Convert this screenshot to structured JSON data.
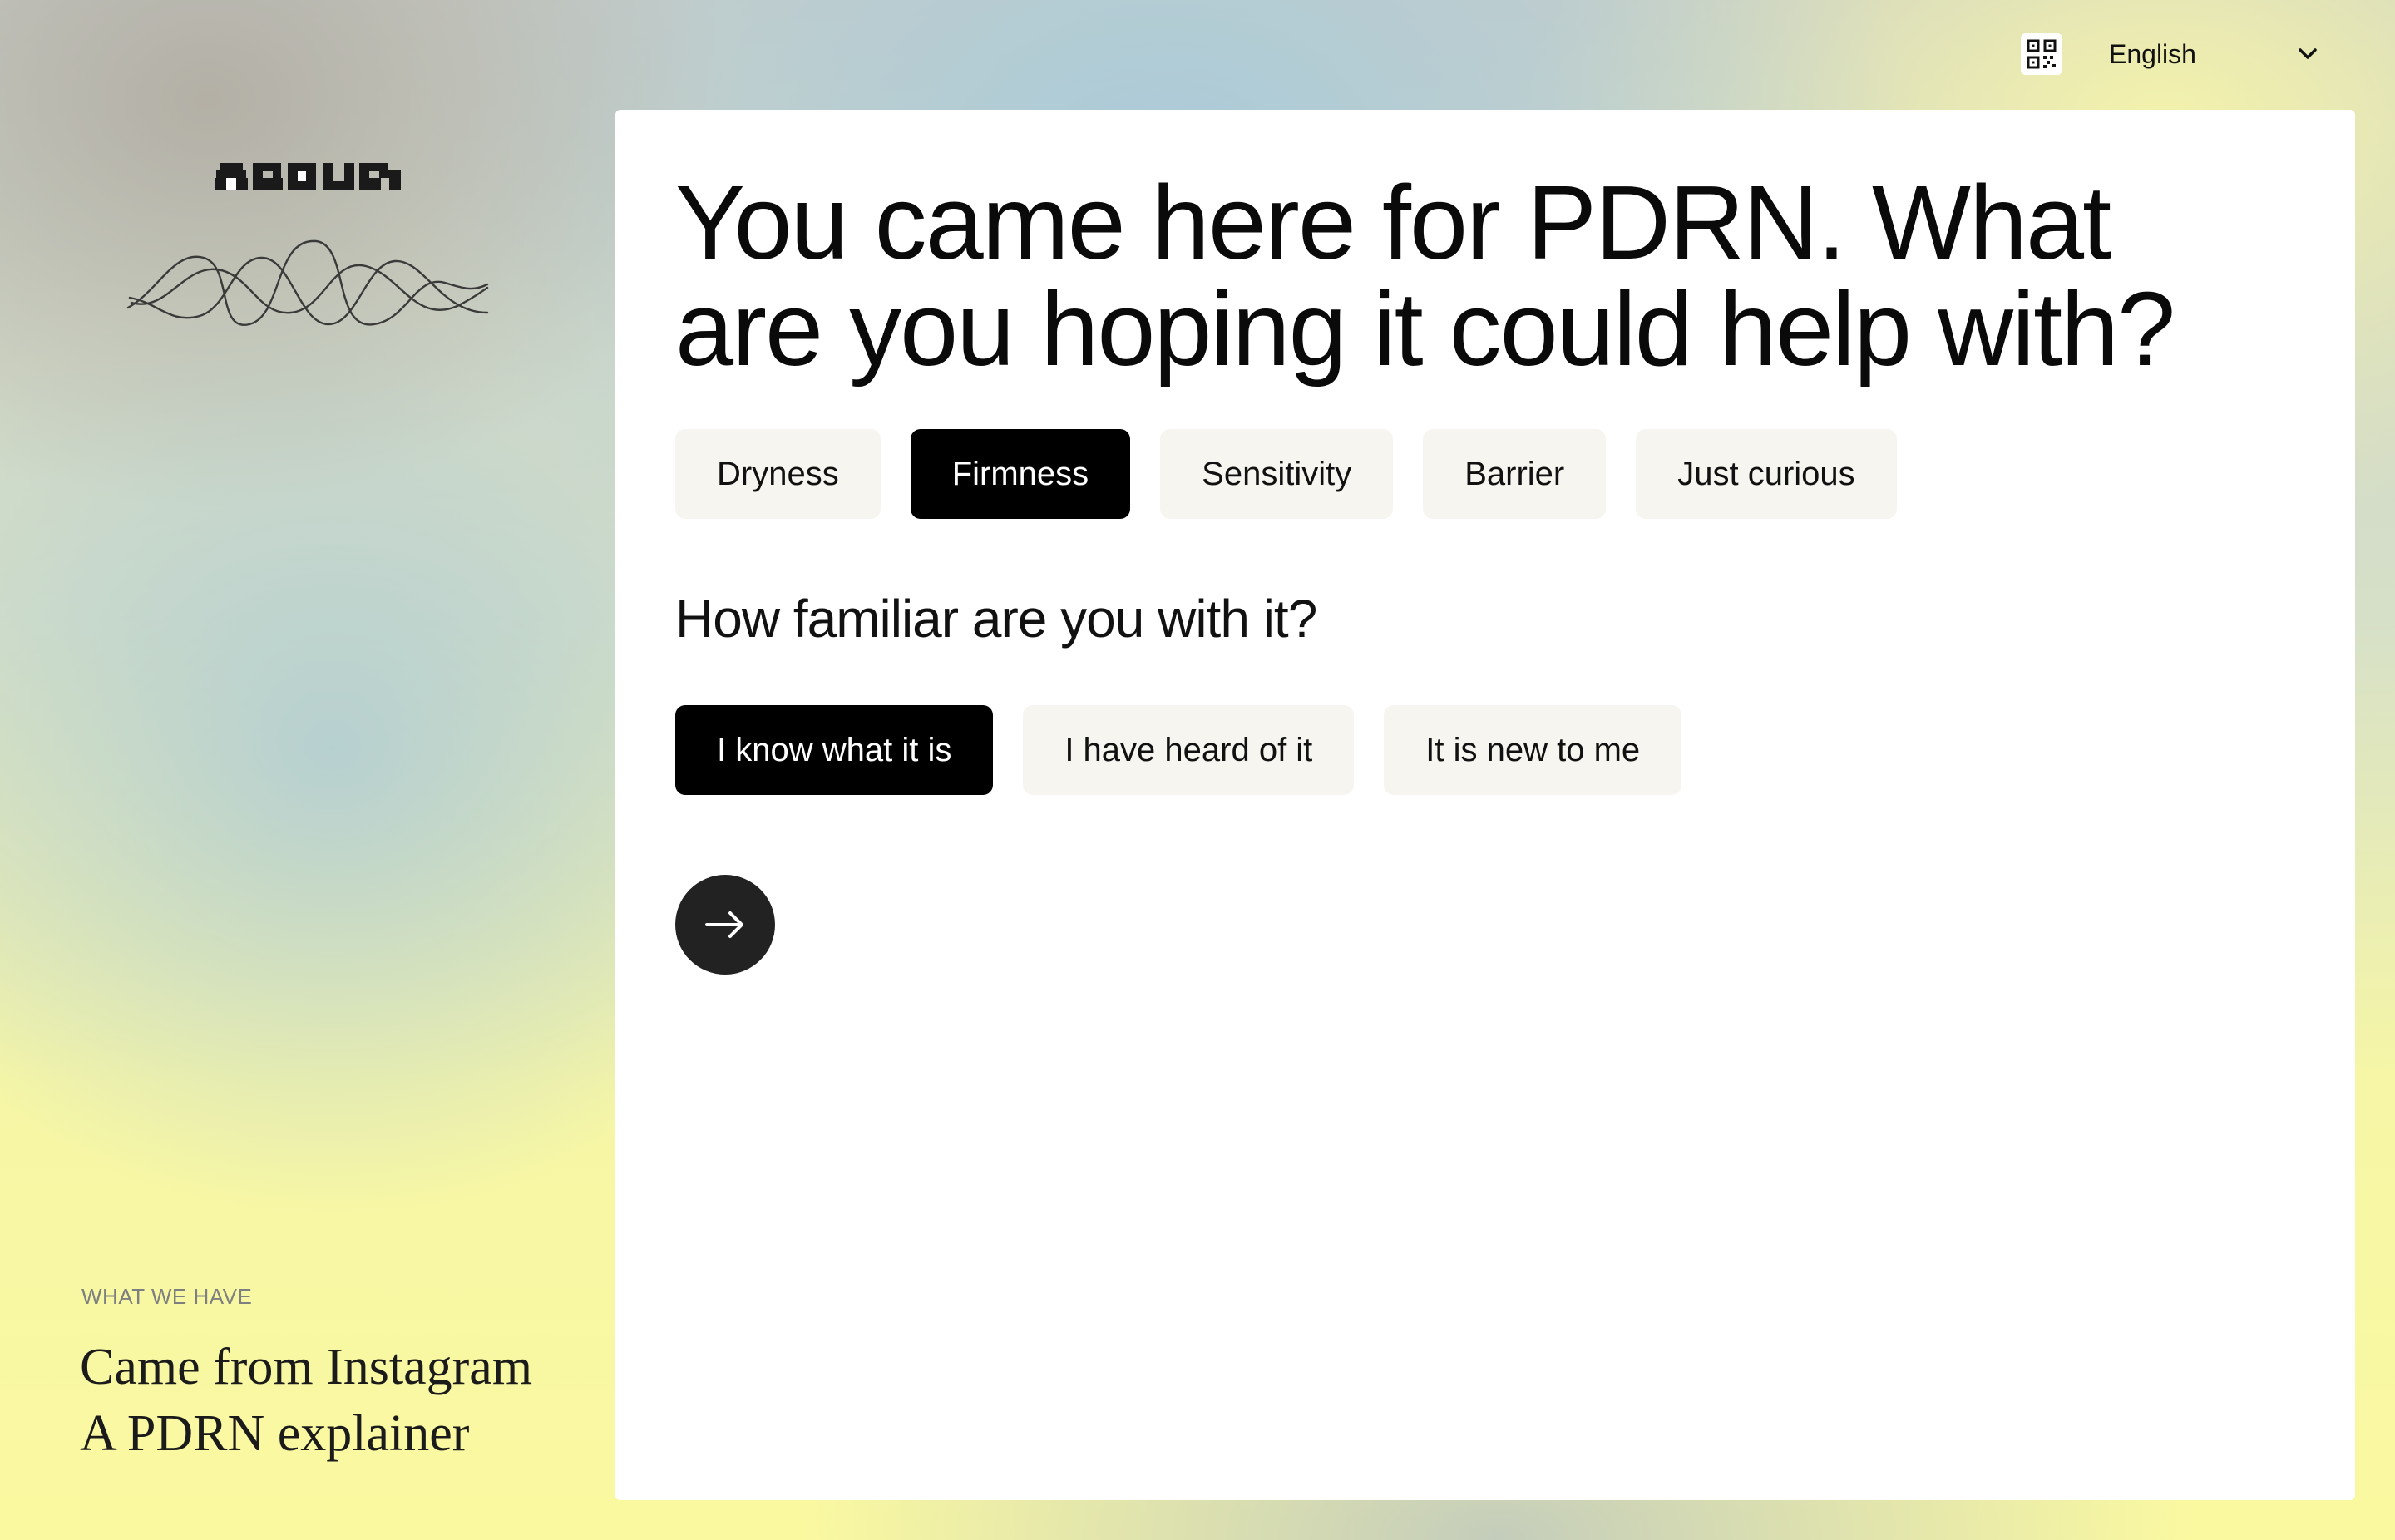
{
  "topbar": {
    "qr_icon": "qr-code-icon",
    "language": "English",
    "language_icon": "chevron-down-icon"
  },
  "sidebar": {
    "brand": "AROURA",
    "decor_icon": "waveform-icon",
    "section_label": "WHAT WE HAVE",
    "story_line1": "Came from Instagram",
    "story_line2": "A PDRN explainer"
  },
  "main": {
    "question1": "You came here for PDRN. What are you hoping it could help with?",
    "concerns": [
      {
        "label": "Dryness",
        "selected": false
      },
      {
        "label": "Firmness",
        "selected": true
      },
      {
        "label": "Sensitivity",
        "selected": false
      },
      {
        "label": "Barrier",
        "selected": false
      },
      {
        "label": "Just curious",
        "selected": false
      }
    ],
    "question2": "How familiar are you with it?",
    "familiarity": [
      {
        "label": "I know what it is",
        "selected": true
      },
      {
        "label": "I have heard of it",
        "selected": false
      },
      {
        "label": "It is new to me",
        "selected": false
      }
    ],
    "next_icon": "arrow-right-icon"
  },
  "colors": {
    "selected_chip": "#000000",
    "chip_background": "#f6f5f0",
    "next_button": "#222222"
  }
}
